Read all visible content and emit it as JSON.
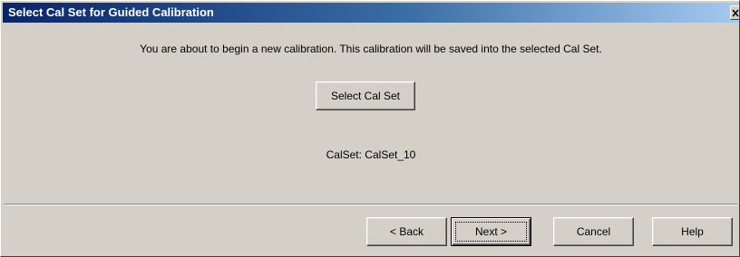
{
  "window": {
    "title": "Select Cal Set for Guided Calibration"
  },
  "message": "You are about to begin a new calibration.  This calibration will be saved into the selected Cal Set.",
  "select_button_label": "Select Cal Set",
  "calset_label": "CalSet: CalSet_10",
  "buttons": {
    "back": "< Back",
    "next": "Next >",
    "cancel": "Cancel",
    "help": "Help"
  },
  "colors": {
    "title_bar_start": "#0a246a",
    "title_bar_end": "#a6caf0",
    "dialog_background": "#d4d0c8"
  },
  "icons": {
    "close": "close-icon"
  }
}
